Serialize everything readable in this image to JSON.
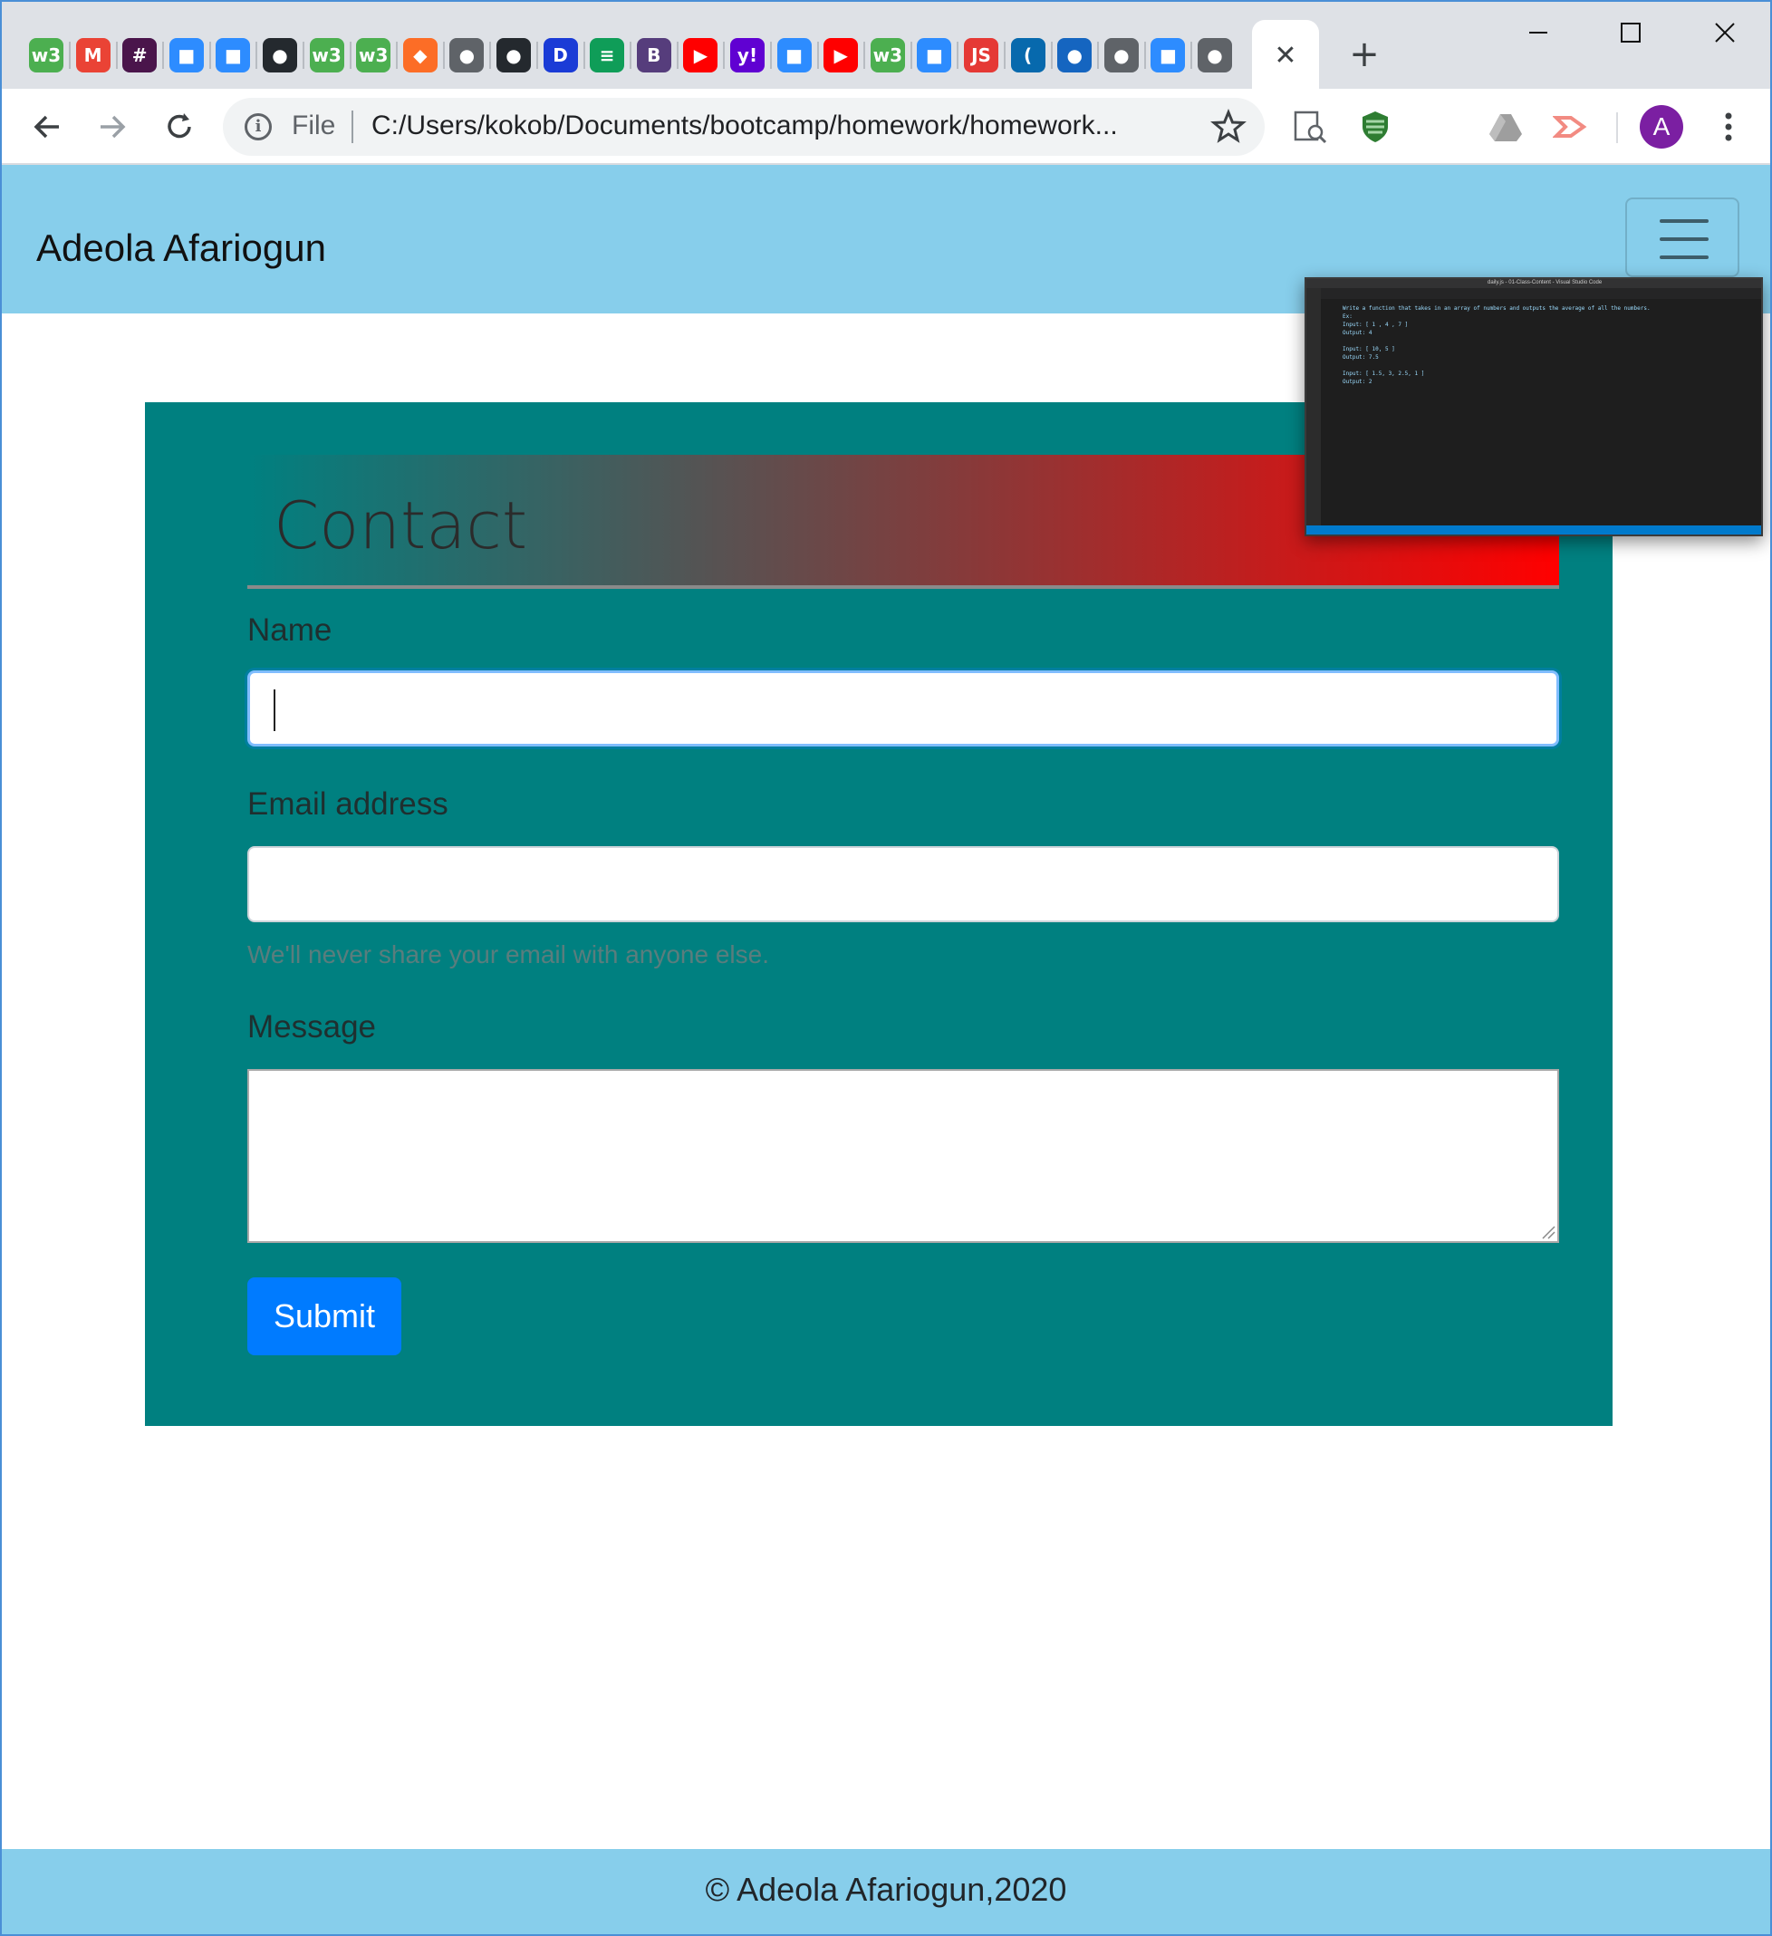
{
  "browser": {
    "tabs": [
      {
        "icon": "w3schools-icon",
        "glyph": "w3",
        "color": "#4caf50"
      },
      {
        "icon": "gmail-icon",
        "glyph": "M",
        "color": "#ea4335"
      },
      {
        "icon": "slack-icon",
        "glyph": "#",
        "color": "#4a154b"
      },
      {
        "icon": "zoom-icon",
        "glyph": "■",
        "color": "#2d8cff"
      },
      {
        "icon": "zoom-icon",
        "glyph": "■",
        "color": "#2d8cff"
      },
      {
        "icon": "github-icon",
        "glyph": "●",
        "color": "#24292e"
      },
      {
        "icon": "w3schools-icon",
        "glyph": "w3",
        "color": "#4caf50"
      },
      {
        "icon": "w3schools-icon",
        "glyph": "w3",
        "color": "#4caf50"
      },
      {
        "icon": "gitlab-icon",
        "glyph": "◆",
        "color": "#fc6d26"
      },
      {
        "icon": "globe-icon",
        "glyph": "●",
        "color": "#5f6368"
      },
      {
        "icon": "github-icon",
        "glyph": "●",
        "color": "#24292e"
      },
      {
        "icon": "disney-plus-icon",
        "glyph": "D",
        "color": "#1a3bd6"
      },
      {
        "icon": "google-sheets-icon",
        "glyph": "≡",
        "color": "#0f9d58"
      },
      {
        "icon": "bootstrap-icon",
        "glyph": "B",
        "color": "#563d7c"
      },
      {
        "icon": "youtube-icon",
        "glyph": "▶",
        "color": "#ff0000"
      },
      {
        "icon": "yahoo-icon",
        "glyph": "y!",
        "color": "#6001d2"
      },
      {
        "icon": "zoom-icon",
        "glyph": "■",
        "color": "#2d8cff"
      },
      {
        "icon": "youtube-icon",
        "glyph": "▶",
        "color": "#ff0000"
      },
      {
        "icon": "w3schools-icon",
        "glyph": "w3",
        "color": "#4caf50"
      },
      {
        "icon": "zoom-icon",
        "glyph": "■",
        "color": "#2d8cff"
      },
      {
        "icon": "javascript-icon",
        "glyph": "JS",
        "color": "#e53935"
      },
      {
        "icon": "jquery-icon",
        "glyph": "(",
        "color": "#0769ad"
      },
      {
        "icon": "globe-icon",
        "glyph": "●",
        "color": "#1565c0"
      },
      {
        "icon": "globe-icon",
        "glyph": "●",
        "color": "#5f6368"
      },
      {
        "icon": "zoom-icon",
        "glyph": "■",
        "color": "#2d8cff"
      },
      {
        "icon": "globe-icon",
        "glyph": "●",
        "color": "#5f6368"
      }
    ],
    "active_tab_close": "✕",
    "new_tab": "+",
    "address": {
      "scheme_label": "File",
      "url": "C:/Users/kokob/Documents/bootcamp/homework/homework..."
    },
    "profile_initial": "A"
  },
  "site": {
    "brand": "Adeola Afariogun",
    "contact": {
      "title": "Contact",
      "name_label": "Name",
      "name_value": "",
      "email_label": "Email address",
      "email_value": "",
      "email_help": "We'll never share your email with anyone else.",
      "message_label": "Message",
      "message_value": "",
      "submit_label": "Submit"
    },
    "footer": "© Adeola Afariogun,2020"
  },
  "preview": {
    "title": "daily.js - 01-Class-Content - Visual Studio Code",
    "code": "Write a function that takes in an array of numbers and outputs the average of all the numbers.\nEx:\nInput: [ 1 , 4 , 7 ]\nOutput: 4\n\nInput: [ 10, 5 ]\nOutput: 7.5\n\nInput: [ 1.5, 3, 2.5, 1 ]\nOutput: 2"
  },
  "colors": {
    "navbar": "#87ceeb",
    "card": "#008080",
    "primary_button": "#007bff",
    "gradient_end": "#ff0000"
  }
}
